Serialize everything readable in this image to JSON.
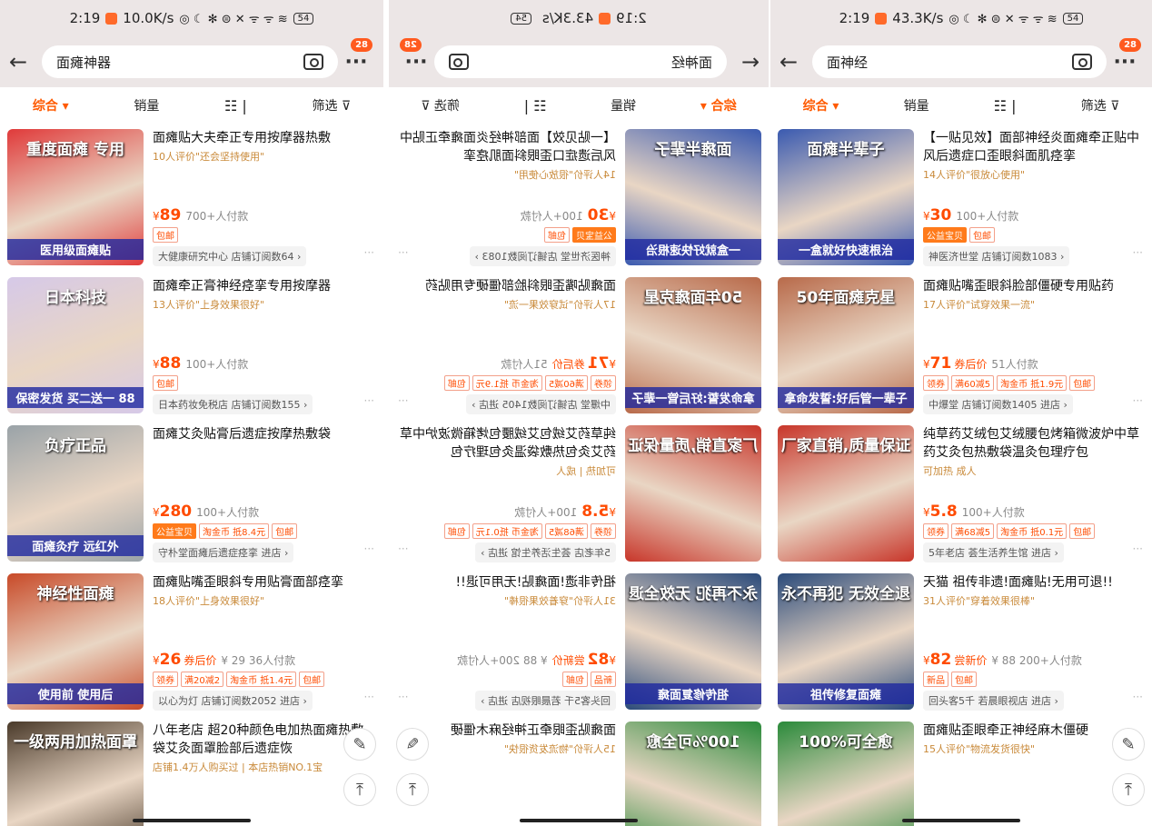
{
  "panel1": {
    "status": {
      "time": "2:19",
      "speed": "10.0K/s",
      "icons": "◎ ☾ ✻ ⊜ ✕ ᯤ ᯤ ≋",
      "battery": "54"
    },
    "search": {
      "query": "面瘫神器",
      "badge": "28"
    },
    "filters": [
      "综合 ▾",
      "销量",
      "筛选 ⊽"
    ],
    "items": [
      {
        "title": "面瘫贴大夫牵正专用按摩器热敷",
        "review": "10人评价\"还会坚持使用\"",
        "price": "89",
        "sales": "700+人付款",
        "tag": "",
        "chips": [
          "包邮"
        ],
        "shop": "大健康研究中心 店铺订阅数64 ›",
        "thumb_text": "重度面瘫 专用",
        "thumb_sub": "医用级面瘫贴",
        "color": "#e03a3a"
      },
      {
        "title": "面瘫牵正膏神经痉挛专用按摩器",
        "review": "13人评价\"上身效果很好\"",
        "price": "88",
        "sales": "100+人付款",
        "tag": "",
        "chips": [
          "包邮"
        ],
        "shop": "日本药妆免税店 店铺订阅数155 ›",
        "thumb_text": "日本科技",
        "thumb_sub": "保密发货 买二送一 88",
        "color": "#d6c9e8"
      },
      {
        "title": "面瘫艾灸贴膏后遗症按摩热敷袋",
        "review": "",
        "price": "280",
        "sales": "100+人付款",
        "tag": "",
        "chips": [
          "公益宝贝",
          "淘金币 抵8.4元",
          "包邮"
        ],
        "shop": "守朴堂面瘫后遗症痉挛 进店 ›",
        "thumb_text": "负疗正品",
        "thumb_sub": "面瘫灸疗 远红外",
        "color": "#9aa3a8"
      },
      {
        "title": "面瘫贴嘴歪眼斜专用贴膏面部痉挛",
        "review": "18人评价\"上身效果很好\"",
        "price": "26",
        "sales": "¥ 29 36人付款",
        "tag": "券后价",
        "chips": [
          "领券",
          "满20减2",
          "淘金币 抵1.4元",
          "包邮"
        ],
        "shop": "以心为灯 店铺订阅数2052 进店 ›",
        "thumb_text": "神经性面瘫",
        "thumb_sub": "使用前 使用后",
        "color": "#c84a28"
      },
      {
        "title": "八年老店 超20种颜色电加热面瘫热敷袋艾灸面罩脸部后遗症恢",
        "review": "店铺1.4万人购买过 | 本店热销NO.1宝",
        "price": "",
        "sales": "",
        "tag": "",
        "chips": [],
        "shop": "",
        "thumb_text": "一级两用加热面罩",
        "thumb_sub": "",
        "color": "#4a3a2a"
      }
    ]
  },
  "panel2": {
    "status": {
      "time": "2:19",
      "speed": "43.3K/s",
      "battery": "54"
    },
    "search": {
      "query": "面神经",
      "badge": "28"
    },
    "filters": [
      "综合 ▾",
      "销量",
      "筛选 ⊽"
    ],
    "items": [
      {
        "title": "【一贴见效】面部神经炎面瘫牵正贴中风后遗症口歪眼斜面肌痉挛",
        "review": "14人评价\"很放心使用\"",
        "price": "30",
        "sales": "100+人付款",
        "chips": [
          "公益宝贝",
          "包邮"
        ],
        "shop": "神医济世堂 店铺订阅数1083 ›",
        "thumb_text": "面瘫半辈子",
        "thumb_sub": "一盒就好快速根治",
        "color": "#3a5ab0"
      },
      {
        "title": "面瘫贴嘴歪眼斜脸部僵硬专用贴药",
        "review": "17人评价\"试穿效果一流\"",
        "price": "71",
        "sales": "51人付款",
        "tag": "券后价",
        "chips": [
          "领券",
          "满60减5",
          "淘金币 抵1.9元",
          "包邮"
        ],
        "shop": "中爆堂 店铺订阅数1405 进店 ›",
        "thumb_text": "50年面瘫克星",
        "thumb_sub": "拿命发誓:好后管一辈子",
        "color": "#b86a4a"
      },
      {
        "title": "纯草药艾绒包艾绒腰包烤箱微波炉中草药艾灸包热敷袋温灸包理疗包",
        "review": "可加热 | 成人",
        "price": "5.8",
        "sales": "100+人付款",
        "tag": "",
        "chips": [
          "领券",
          "满68减5",
          "淘金币 抵0.1元",
          "包邮"
        ],
        "shop": "5年老店 荟生活养生馆 进店 ›",
        "thumb_text": "厂家直销,质量保证",
        "thumb_sub": "",
        "color": "#c8362a"
      },
      {
        "title": "祖传非遗!面瘫贴!无用可退!!",
        "review": "31人评价\"穿着效果很棒\"",
        "price": "82",
        "sales": "¥ 88 200+人付款",
        "tag": "尝新价",
        "chips": [
          "新品",
          "包邮"
        ],
        "shop": "回头客5千 若晨眼视店 进店 ›",
        "thumb_text": "永不再犯 无效全退",
        "thumb_sub": "祖传修复面瘫",
        "color": "#2a4a7a"
      },
      {
        "title": "面瘫贴歪眼牵正神经麻木僵硬",
        "review": "15人评价\"物流发货很快\"",
        "price": "",
        "sales": "",
        "chips": [],
        "shop": "",
        "thumb_text": "100%可全愈",
        "thumb_sub": "",
        "color": "#2a8a3a"
      }
    ]
  },
  "panel3": {
    "status": {
      "time": "2:19",
      "speed": "43.3K/s",
      "icons": "◎ ☾ ✻ ⊜ ✕ ᯤ ᯤ ≋",
      "battery": "54"
    },
    "search": {
      "query": "面神经",
      "badge": "28"
    },
    "filters": [
      "综合 ▾",
      "销量",
      "筛选 ⊽"
    ],
    "items": [
      {
        "title": "【一贴见效】面部神经炎面瘫牵正贴中风后遗症口歪眼斜面肌痉挛",
        "review": "14人评价\"很放心使用\"",
        "price": "30",
        "sales": "100+人付款",
        "tag": "",
        "chips": [
          "公益宝贝",
          "包邮"
        ],
        "shop": "神医济世堂 店铺订阅数1083 ›",
        "thumb_text": "面瘫半辈子",
        "thumb_sub": "一盒就好快速根治",
        "color": "#3a5ab0"
      },
      {
        "title": "面瘫贴嘴歪眼斜脸部僵硬专用贴药",
        "review": "17人评价\"试穿效果一流\"",
        "price": "71",
        "sales": "51人付款",
        "tag": "券后价",
        "chips": [
          "领券",
          "满60减5",
          "淘金币 抵1.9元",
          "包邮"
        ],
        "shop": "中爆堂 店铺订阅数1405 进店 ›",
        "thumb_text": "50年面瘫克星",
        "thumb_sub": "拿命发誓:好后管一辈子",
        "color": "#b86a4a"
      },
      {
        "title": "纯草药艾绒包艾绒腰包烤箱微波炉中草药艾灸包热敷袋温灸包理疗包",
        "review": "可加热 成人",
        "price": "5.8",
        "sales": "100+人付款",
        "tag": "",
        "chips": [
          "领券",
          "满68减5",
          "淘金币 抵0.1元",
          "包邮"
        ],
        "shop": "5年老店 荟生活养生馆 进店 ›",
        "thumb_text": "厂家直销,质量保证",
        "thumb_sub": "",
        "color": "#c8362a"
      },
      {
        "title": "天猫 祖传非遗!面瘫贴!无用可退!!",
        "review": "31人评价\"穿着效果很棒\"",
        "price": "82",
        "sales": "¥ 88 200+人付款",
        "tag": "尝新价",
        "chips": [
          "新品",
          "包邮"
        ],
        "shop": "回头客5千 若晨眼视店 进店 ›",
        "thumb_text": "永不再犯 无效全退",
        "thumb_sub": "祖传修复面瘫",
        "color": "#2a4a7a"
      },
      {
        "title": "面瘫贴歪眼牵正神经麻木僵硬",
        "review": "15人评价\"物流发货很快\"",
        "price": "",
        "sales": "",
        "tag": "",
        "chips": [],
        "shop": "",
        "thumb_text": "100%可全愈",
        "thumb_sub": "",
        "color": "#2a8a3a"
      }
    ]
  }
}
